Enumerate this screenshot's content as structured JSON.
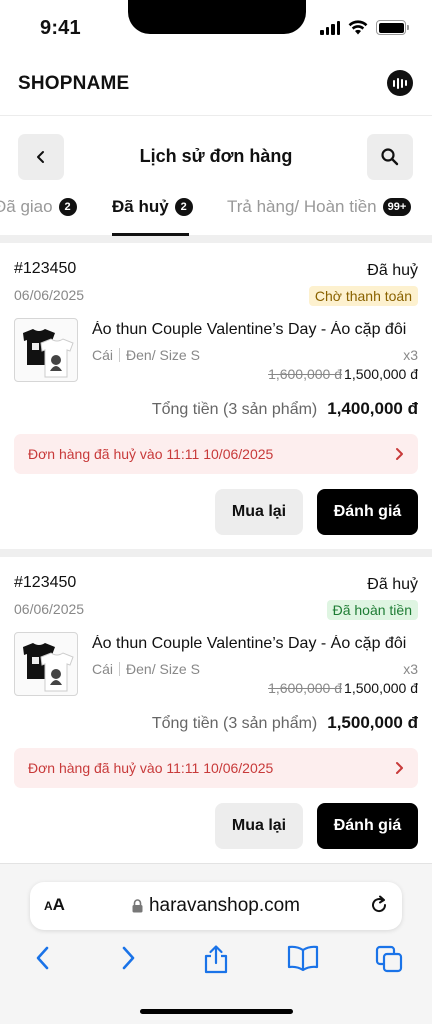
{
  "status_bar": {
    "time": "9:41"
  },
  "app_header": {
    "shop_name": "SHOPNAME",
    "chat_icon": "chat-bubble-icon"
  },
  "page": {
    "title": "Lịch sử đơn hàng"
  },
  "tabs": [
    {
      "label": "Đã giao",
      "count": "2",
      "active": false
    },
    {
      "label": "Đã huỷ",
      "count": "2",
      "active": true
    },
    {
      "label": "Trả hàng/ Hoàn tiền",
      "count": "99+",
      "active": false
    }
  ],
  "orders": [
    {
      "id": "#123450",
      "date": "06/06/2025",
      "status": "Đã huỷ",
      "badge": "Chờ thanh toán",
      "badge_color": "#fdf1cf",
      "product": {
        "name": "Áo thun Couple Valentine’s Day - Áo cặp đôi",
        "unit": "Cái",
        "variant": "Đen/ Size S",
        "qty": "x3",
        "old_price": "1,600,000 đ",
        "price": "1,500,000 đ"
      },
      "total_label": "Tổng tiền (3 sản phẩm)",
      "total": "1,400,000 đ",
      "cancel_note": "Đơn hàng đã huỷ vào 11:11 10/06/2025",
      "rebuy_label": "Mua lại",
      "review_label": "Đánh giá"
    },
    {
      "id": "#123450",
      "date": "06/06/2025",
      "status": "Đã huỷ",
      "badge": "Đã hoàn tiền",
      "badge_color": "#dff5e2",
      "product": {
        "name": "Áo thun Couple Valentine’s Day - Áo cặp đôi",
        "unit": "Cái",
        "variant": "Đen/ Size S",
        "qty": "x3",
        "old_price": "1,600,000 đ",
        "price": "1,500,000 đ"
      },
      "total_label": "Tổng tiền (3 sản phẩm)",
      "total": "1,500,000 đ",
      "cancel_note": "Đơn hàng đã huỷ vào 11:11 10/06/2025",
      "rebuy_label": "Mua lại",
      "review_label": "Đánh giá"
    }
  ],
  "browser": {
    "aa_small": "A",
    "aa_large": "A",
    "url": "haravanshop.com",
    "accent": "#1a73e8"
  }
}
